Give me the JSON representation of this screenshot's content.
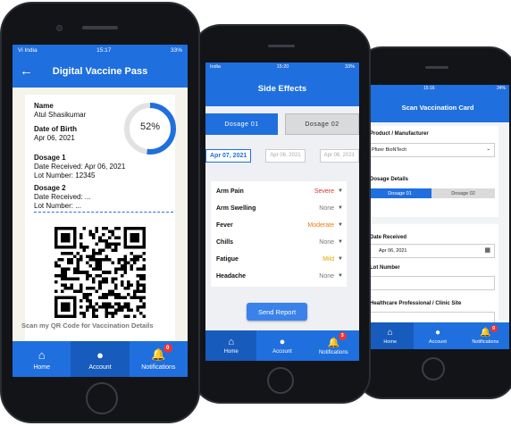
{
  "colors": {
    "primary": "#1f6fde",
    "severe": "#e0302a",
    "moderate": "#ea7b12",
    "mild": "#e0a800",
    "none": "#777777"
  },
  "phone1": {
    "status": {
      "carrier": "Vi India",
      "time": "15:17",
      "battery": "33%"
    },
    "title": "Digital Vaccine Pass",
    "name_label": "Name",
    "name_value": "Atul Shasikumar",
    "dob_label": "Date of Birth",
    "dob_value": "Apr 06, 2021",
    "progress_percent": 52,
    "progress_text": "52%",
    "dosage1": {
      "label": "Dosage 1",
      "received": "Date Received: Apr 06, 2021",
      "lot": "Lot Number: 12345"
    },
    "dosage2": {
      "label": "Dosage 2",
      "received": "Date Received: ...",
      "lot": "Lot Number: ..."
    },
    "scan_text": "Scan my QR Code for Vaccination Details",
    "nav": {
      "home": "Home",
      "account": "Account",
      "notifications": "Notifications",
      "badge": "0"
    }
  },
  "phone2": {
    "status": {
      "carrier": "India",
      "time": "15:20",
      "battery": "33%"
    },
    "title": "Side Effects",
    "tabs": [
      "Dosage 01",
      "Dosage 02"
    ],
    "dates": [
      "Apr 07, 2021",
      "Apr 06, 2021",
      "Apr 06, 2021"
    ],
    "effects": [
      {
        "name": "Arm Pain",
        "severity": "Severe"
      },
      {
        "name": "Arm Swelling",
        "severity": "None"
      },
      {
        "name": "Fever",
        "severity": "Moderate"
      },
      {
        "name": "Chills",
        "severity": "None"
      },
      {
        "name": "Fatigue",
        "severity": "Mild"
      },
      {
        "name": "Headache",
        "severity": "None"
      }
    ],
    "send_label": "Send Report",
    "nav": {
      "home": "Home",
      "account": "Account",
      "notifications": "Notifications",
      "badge": "3"
    }
  },
  "phone3": {
    "status": {
      "time": "15:16",
      "battery": "34%"
    },
    "title": "Scan Vaccination Card",
    "product_label": "Product / Manufacturer",
    "product_value": "Pfizer BioNTech",
    "dosage_details_label": "Dosage Details",
    "tabs": [
      "Dosage 01",
      "Dosage 02"
    ],
    "date_label": "Date Received",
    "date_value": "Apr 06, 2021",
    "lot_label": "Lot Number",
    "site_label": "Healthcare Professional / Clinic Site",
    "nav": {
      "home": "Home",
      "account": "Account",
      "notifications": "Notifications",
      "badge": "0"
    }
  }
}
